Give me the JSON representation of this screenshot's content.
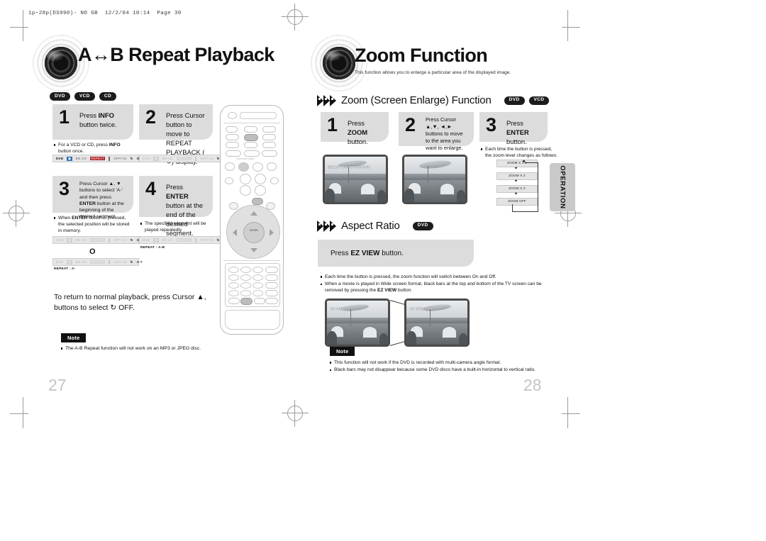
{
  "slug": "1p~28p(DS990)- NO GB  12/2/04 10:14  Page 30",
  "left_page": {
    "number": "27",
    "title": "A↔B Repeat Playback",
    "badges": [
      "DVD",
      "VCD",
      "CD"
    ],
    "steps": [
      {
        "num": "1",
        "text_html": "Press <b>INFO</b> button twice.",
        "bullets": [
          "For a VCD or CD, press <b>INFO</b> button once."
        ]
      },
      {
        "num": "2",
        "text_html": "Press Cursor button to move to REPEAT PLAYBACK ( ↻) display.",
        "bullets": []
      },
      {
        "num": "3",
        "text_html": "Press Cursor ▲, ▼ buttons to select 'A-' and then press <b>ENTER</b> button at the beginning of the desired segment.",
        "bullets": [
          "When <b>ENTER</b> button is pressed, the selected position will be stored in memory."
        ]
      },
      {
        "num": "4",
        "text_html": "Press <b>ENTER</b> button at the end of the desired segment.",
        "bullets": [
          "The specified segment will be played repeatedly."
        ]
      }
    ],
    "osd_bars": [
      {
        "cells": [
          "DVD",
          "EN 1/3",
          "REPEAT",
          "OFF/ 01",
          "OFF"
        ],
        "dim": false
      },
      {
        "cells": [
          "DVD",
          "EN 1/3",
          "REPEAT",
          "OFF/ 01",
          "OFF"
        ],
        "dim": true
      },
      {
        "cells": [
          "DVD",
          "EN 1/3",
          "REPEAT",
          "OFF/ 01",
          "A-"
        ],
        "dim": true
      },
      {
        "cells": [
          "DVD",
          "EN 1/3",
          "REPEAT",
          "OFF/ 01",
          "A-?"
        ],
        "dim": true
      },
      {
        "cells": [
          "DVD",
          "EN 1/3",
          "REPEAT",
          "OFF/ 01",
          "A-B"
        ],
        "dim": true
      }
    ],
    "repeat_labels": [
      "REPEAT : A-",
      "REPEAT : A-B"
    ],
    "circle_marker": "O",
    "footer_text_html": "To return to normal playback, press Cursor ▲, buttons to select ↻ OFF.",
    "note_label": "Note",
    "note_bullets": [
      "The A-B Repeat function will not work on an MP3 or JPEG disc."
    ]
  },
  "right_page": {
    "number": "28",
    "title": "Zoom Function",
    "subtitle": "This function allows you to enlarge a particular area of the displayed image.",
    "sections": [
      {
        "heading": "Zoom (Screen Enlarge) Function",
        "badges": [
          "DVD",
          "VCD"
        ]
      },
      {
        "heading": "Aspect Ratio",
        "badges": [
          "DVD"
        ]
      }
    ],
    "zoom_steps": [
      {
        "num": "1",
        "text_html": "Press <b>ZOOM</b> button."
      },
      {
        "num": "2",
        "text_html": "Press Cursor ▲,▼, ◄,► buttons to move to the area you want to enlarge."
      },
      {
        "num": "3",
        "text_html": "Press <b>ENTER</b> button."
      }
    ],
    "zoom_bullet": "Each time the button is pressed, the zoom level changes as follows:",
    "zoom_levels": [
      "ZOOM X 1.5",
      "ZOOM X 2",
      "ZOOM X 3",
      "ZOOM OFF"
    ],
    "tv_labels": [
      "SELECT ZOOM POSITION",
      "",
      "EZ VIEW",
      "EZ VIEW OFF"
    ],
    "aspect_step_html": "Press <b>EZ VIEW</b> button.",
    "aspect_bullets": [
      "Each time the button is pressed, the zoom function will switch between On and Off.",
      "When a movie is played in Wide screen format, black bars at the top and bottom of the TV screen can be removed by pressing the <b>EZ VIEW</b> button."
    ],
    "note_label": "Note",
    "note_bullets": [
      "This function will not work if the DVD is recorded with multi-camera angle format.",
      "Black bars may not disappear because some DVD discs have a built-in horizontal to vertical ratio."
    ],
    "side_tab": "OPERATION"
  }
}
